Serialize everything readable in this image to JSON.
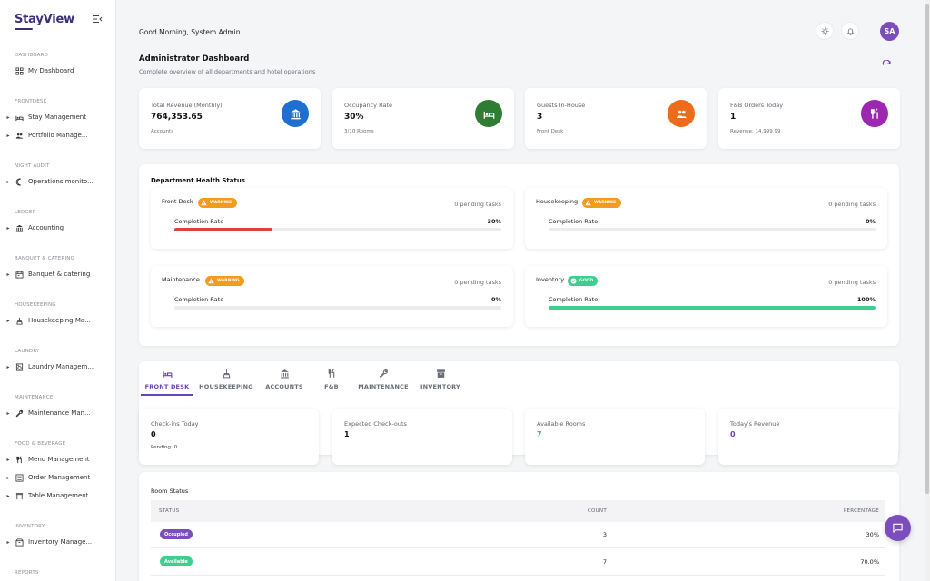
{
  "app": {
    "brand": "StayView"
  },
  "sidebar": {
    "sections": [
      {
        "label": "DASHBOARD",
        "items": [
          {
            "label": "My Dashboard",
            "icon": "grid-icon",
            "has_caret": false
          }
        ]
      },
      {
        "label": "FRONTDESK",
        "items": [
          {
            "label": "Stay Management",
            "icon": "bed-icon",
            "has_caret": true
          },
          {
            "label": "Portfolio Manage...",
            "icon": "people-icon",
            "has_caret": true
          }
        ]
      },
      {
        "label": "NIGHT AUDIT",
        "items": [
          {
            "label": "Operations monito...",
            "icon": "moon-icon",
            "has_caret": true
          }
        ]
      },
      {
        "label": "LEDGER",
        "items": [
          {
            "label": "Accounting",
            "icon": "bank-icon",
            "has_caret": true
          }
        ]
      },
      {
        "label": "BANQUET & CATERING",
        "items": [
          {
            "label": "Banquet & catering",
            "icon": "calendar-icon",
            "has_caret": true
          }
        ]
      },
      {
        "label": "HOUSEKEEPING",
        "items": [
          {
            "label": "Housekeeping Ma...",
            "icon": "broom-icon",
            "has_caret": true
          }
        ]
      },
      {
        "label": "LAUNDRY",
        "items": [
          {
            "label": "Laundry Managem...",
            "icon": "washer-icon",
            "has_caret": true
          }
        ]
      },
      {
        "label": "MAINTENANCE",
        "items": [
          {
            "label": "Maintenance Man...",
            "icon": "wrench-icon",
            "has_caret": true
          }
        ]
      },
      {
        "label": "FOOD & BEVERAGE",
        "items": [
          {
            "label": "Menu Management",
            "icon": "utensils-icon",
            "has_caret": true
          },
          {
            "label": "Order Management",
            "icon": "list-icon",
            "has_caret": true
          },
          {
            "label": "Table Management",
            "icon": "table-icon",
            "has_caret": true
          }
        ]
      },
      {
        "label": "INVENTORY",
        "items": [
          {
            "label": "Inventory Manage...",
            "icon": "box-icon",
            "has_caret": true
          }
        ]
      },
      {
        "label": "REPORTS",
        "items": []
      }
    ]
  },
  "header": {
    "greeting": "Good Morning, System Admin",
    "avatar_initials": "SA",
    "title": "Administrator Dashboard",
    "subtitle": "Complete overview of all departments and hotel operations"
  },
  "stats": [
    {
      "label": "Total Revenue (Monthly)",
      "value": "764,353.65",
      "sub": "Accounts",
      "icon": "bank-icon",
      "color": "#1e6fd0"
    },
    {
      "label": "Occupancy Rate",
      "value": "30%",
      "sub": "3/10 Rooms",
      "icon": "bed-icon",
      "color": "#2e7d32"
    },
    {
      "label": "Guests In-House",
      "value": "3",
      "sub": "Front Desk",
      "icon": "people-icon",
      "color": "#ec6c1c"
    },
    {
      "label": "F&B Orders Today",
      "value": "1",
      "sub": "Revenue: 14,999.99",
      "icon": "utensils-icon",
      "color": "#9c27b0"
    }
  ],
  "department_health": {
    "title": "Department Health Status",
    "completion_label": "Completion Rate",
    "departments": [
      {
        "name": "Front Desk",
        "status": "WARNING",
        "status_color": "#f29b1d",
        "pending": "0 pending tasks",
        "completion": "30%",
        "fill": 0.3,
        "fill_color": "#d94145"
      },
      {
        "name": "Housekeeping",
        "status": "WARNING",
        "status_color": "#f29b1d",
        "pending": "0 pending tasks",
        "completion": "0%",
        "fill": 0,
        "fill_color": "#d94145"
      },
      {
        "name": "Maintenance",
        "status": "WARNING",
        "status_color": "#f29b1d",
        "pending": "0 pending tasks",
        "completion": "0%",
        "fill": 0,
        "fill_color": "#d94145"
      },
      {
        "name": "Inventory",
        "status": "GOOD",
        "status_color": "#3ecf8e",
        "pending": "0 pending tasks",
        "completion": "100%",
        "fill": 1.0,
        "fill_color": "#3ecf8e"
      }
    ]
  },
  "tabs": [
    {
      "label": "FRONT DESK",
      "icon": "bed-icon",
      "active": true
    },
    {
      "label": "HOUSEKEEPING",
      "icon": "broom-icon",
      "active": false
    },
    {
      "label": "ACCOUNTS",
      "icon": "bank-icon",
      "active": false
    },
    {
      "label": "F&B",
      "icon": "utensils-icon",
      "active": false
    },
    {
      "label": "MAINTENANCE",
      "icon": "wrench-icon",
      "active": false
    },
    {
      "label": "INVENTORY",
      "icon": "archive-icon",
      "active": false
    }
  ],
  "metrics": [
    {
      "label": "Check-ins Today",
      "value": "0",
      "sub": "Pending: 0",
      "color": "#111111"
    },
    {
      "label": "Expected Check-outs",
      "value": "1",
      "sub": "",
      "color": "#111111"
    },
    {
      "label": "Available Rooms",
      "value": "7",
      "sub": "",
      "color": "#2bbd8a"
    },
    {
      "label": "Today's Revenue",
      "value": "0",
      "sub": "",
      "color": "#6e42b8"
    }
  ],
  "room_status": {
    "title": "Room Status",
    "columns": [
      "STATUS",
      "COUNT",
      "PERCENTAGE"
    ],
    "rows": [
      {
        "status": "Occupied",
        "color": "#7c4dbd",
        "count": "3",
        "percentage": "30%"
      },
      {
        "status": "Available",
        "color": "#3ecf8e",
        "count": "7",
        "percentage": "70.0%"
      }
    ]
  },
  "colors": {
    "accent": "#6e42b8",
    "brand": "#3a2f7a"
  }
}
